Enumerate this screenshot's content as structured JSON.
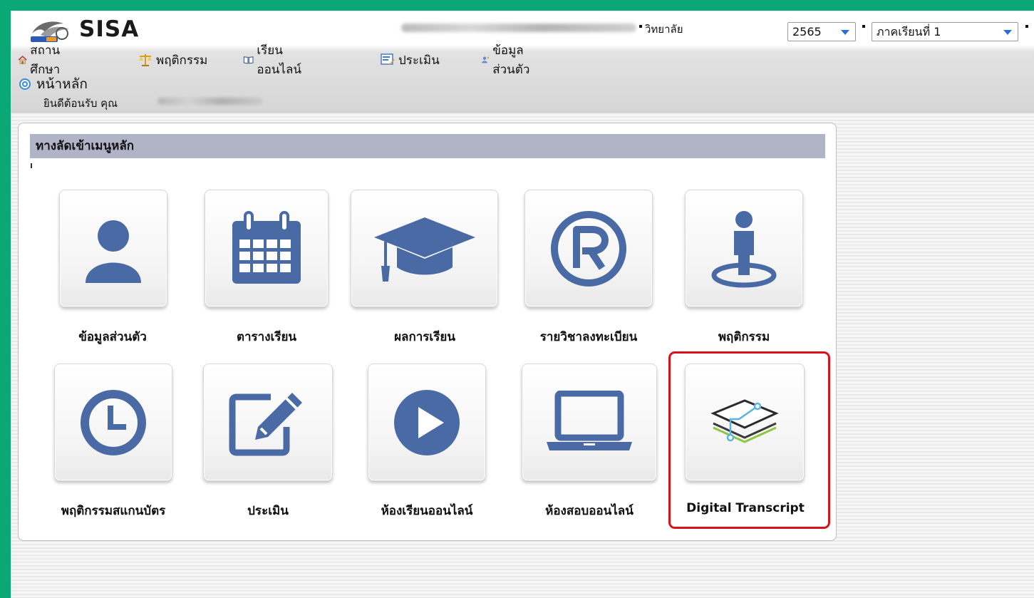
{
  "app": {
    "name": "SISA"
  },
  "header": {
    "org_label": "วิทยาลัย",
    "year": "2565",
    "term": "ภาคเรียนที่ 1"
  },
  "menu": [
    {
      "label": "สถานศึกษา",
      "icon": "school-house-icon"
    },
    {
      "label": "พฤติกรรม",
      "icon": "balance-scale-icon"
    },
    {
      "label": "เรียนออนไลน์",
      "icon": "open-book-icon"
    },
    {
      "label": "ประเมิน",
      "icon": "evaluation-form-icon"
    },
    {
      "label": "ข้อมูลส่วนตัว",
      "icon": "user-tools-icon"
    }
  ],
  "home": {
    "label": "หน้าหลัก",
    "icon": "gear-icon"
  },
  "welcome": {
    "prefix": "ยินดีต้อนรับ คุณ"
  },
  "shortcuts": {
    "title": "ทางลัดเข้าเมนูหลัก",
    "tiles": [
      {
        "label": "ข้อมูลส่วนตัว",
        "icon": "user-icon"
      },
      {
        "label": "ตารางเรียน",
        "icon": "calendar-icon"
      },
      {
        "label": "ผลการเรียน",
        "icon": "graduation-cap-icon"
      },
      {
        "label": "รายวิชาลงทะเบียน",
        "icon": "registered-icon"
      },
      {
        "label": "พฤติกรรม",
        "icon": "person-location-icon"
      },
      {
        "label": "พฤติกรรมสแกนบัตร",
        "icon": "clock-icon"
      },
      {
        "label": "ประเมิน",
        "icon": "edit-icon"
      },
      {
        "label": "ห้องเรียนออนไลน์",
        "icon": "play-icon"
      },
      {
        "label": "ห้องสอบออนไลน์",
        "icon": "laptop-icon"
      },
      {
        "label": "Digital Transcript",
        "icon": "digital-transcript-icon"
      }
    ]
  },
  "colors": {
    "frame": "#0aa874",
    "icon_blue": "#4a6aa5",
    "panel_title_bg": "#b1b3c7",
    "highlight": "#d9121c",
    "select_arrow": "#2a6fd8"
  }
}
